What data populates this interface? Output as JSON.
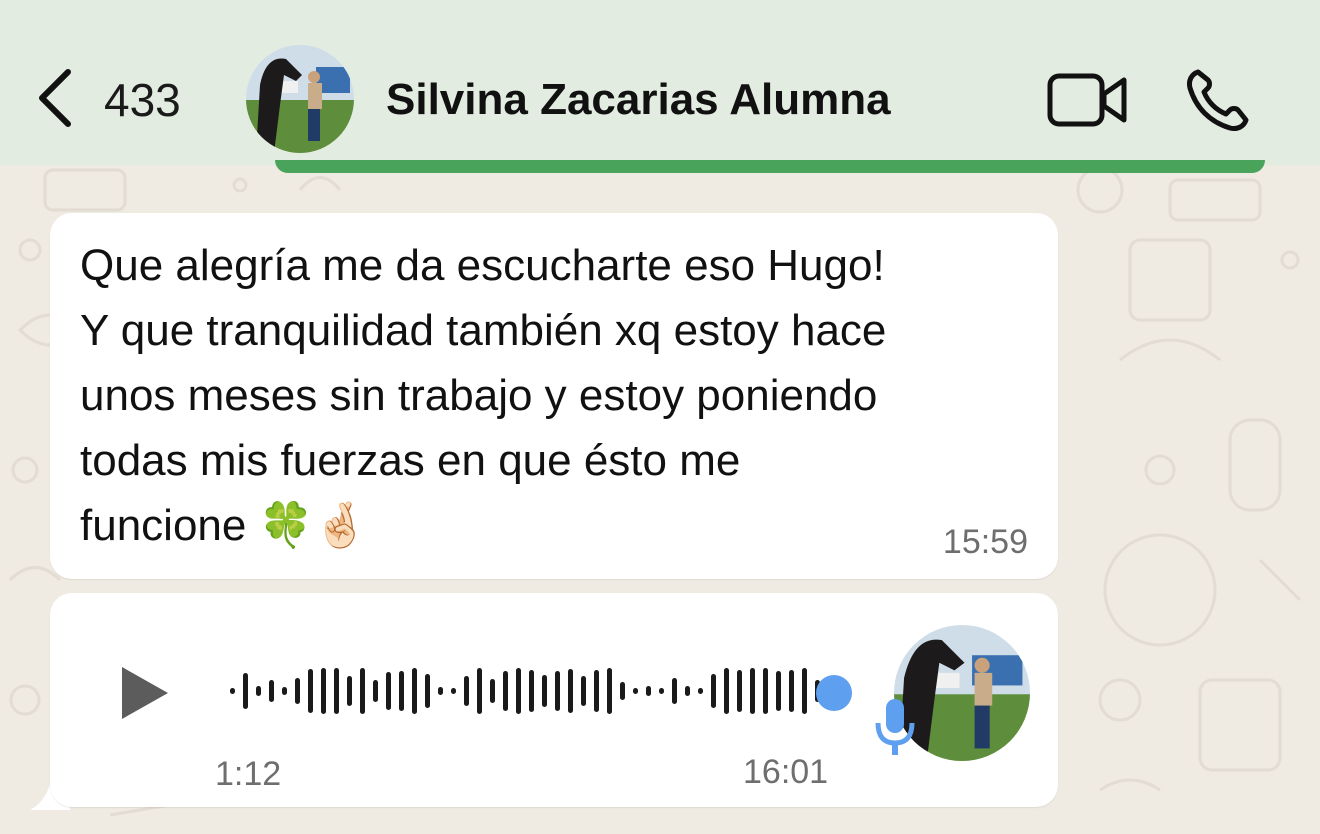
{
  "header": {
    "back_count": "433",
    "contact_name": "Silvina Zacarias Alumna"
  },
  "messages": [
    {
      "type": "text",
      "text": "Que alegría me da escucharte eso Hugo!\nY que tranquilidad también xq estoy hace\nunos meses sin trabajo y estoy poniendo\ntodas mis fuerzas en que ésto me\nfuncione 🍀🤞🏻",
      "time": "15:59"
    },
    {
      "type": "voice",
      "duration": "1:12",
      "time": "16:01",
      "progress": 0.0
    }
  ],
  "colors": {
    "header_bg": "#e2ece0",
    "chat_bg": "#efeae2",
    "bubble": "#ffffff",
    "voice_dot": "#5f9fef",
    "mic": "#5f9fef"
  },
  "icons": [
    "back-chevron-icon",
    "video-call-icon",
    "phone-icon",
    "play-icon",
    "microphone-icon"
  ]
}
